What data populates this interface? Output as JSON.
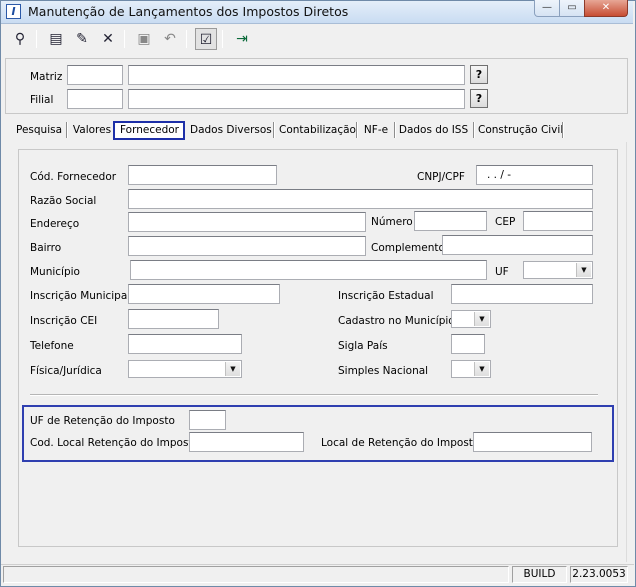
{
  "window": {
    "title": "Manutenção de Lançamentos dos Impostos Diretos",
    "app_icon": "I",
    "controls": {
      "minimize": "—",
      "maximize": "▭",
      "close": "✕"
    }
  },
  "toolbar": {
    "icons": [
      "binoculars-icon",
      "new-document-icon",
      "edit-icon",
      "delete-icon",
      "save-icon",
      "undo-icon",
      "checklist-icon",
      "exit-icon"
    ],
    "glyphs": {
      "find": "⚲",
      "new": "▤",
      "edit": "✎",
      "delete": "✕",
      "save": "▣",
      "undo": "↶",
      "check": "☑",
      "exit": "⇥"
    }
  },
  "header": {
    "matriz_label": "Matriz",
    "filial_label": "Filial",
    "lookup_label": "?"
  },
  "tabs": [
    {
      "label": "Pesquisa"
    },
    {
      "label": "Valores"
    },
    {
      "label": "Fornecedor"
    },
    {
      "label": "Dados Diversos"
    },
    {
      "label": "Contabilização"
    },
    {
      "label": "NF-e"
    },
    {
      "label": "Dados do ISS"
    },
    {
      "label": "Construção Civil"
    }
  ],
  "active_tab": "Fornecedor",
  "form": {
    "cod_fornecedor": "Cód. Fornecedor",
    "cnpj_cpf": "CNPJ/CPF",
    "cnpj_mask": ". . /  -",
    "razao_social": "Razão Social",
    "endereco": "Endereço",
    "numero": "Número",
    "cep": "CEP",
    "bairro": "Bairro",
    "complemento": "Complemento",
    "municipio": "Município",
    "uf": "UF",
    "inscricao_municipal": "Inscrição Municipal",
    "inscricao_estadual": "Inscrição Estadual",
    "inscricao_cei": "Inscrição CEI",
    "cadastro_municipio": "Cadastro no Município",
    "telefone": "Telefone",
    "sigla_pais": "Sigla País",
    "fisica_juridica": "Física/Jurídica",
    "simples_nacional": "Simples Nacional"
  },
  "retention": {
    "uf_retencao": "UF de Retenção do Imposto",
    "cod_local_retencao": "Cod. Local Retenção do Imposto",
    "local_retencao": "Local de Retenção do Imposto"
  },
  "status": {
    "build_label": "BUILD",
    "version": "2.23.0053"
  },
  "colors": {
    "highlight_border": "#1d2fa8",
    "window_bg": "#f0f0f0",
    "close_button": "#c74d33"
  }
}
